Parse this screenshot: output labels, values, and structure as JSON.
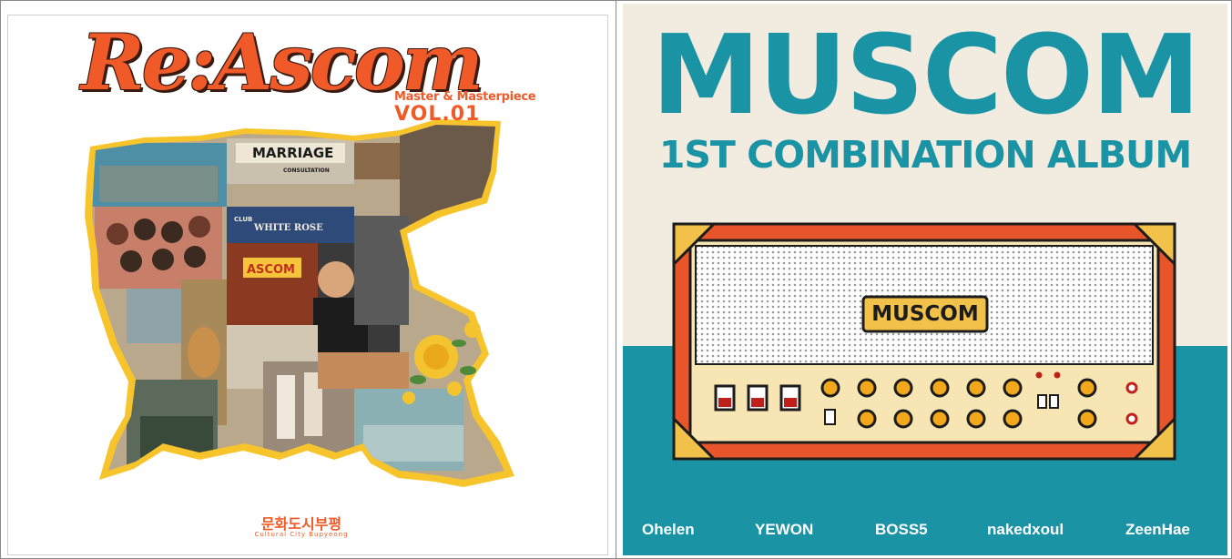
{
  "left_cover": {
    "title": "Re:Ascom",
    "subtitle": "Master & Masterpiece",
    "volume": "VOL.01",
    "signs": {
      "marriage": "MARRIAGE",
      "consultation": "CONSULTATION",
      "club": "CLUB",
      "white_rose": "WHITE ROSE",
      "ascom": "ASCOM"
    },
    "footer_logo": "문화도시부평",
    "footer_sub": "Cultural City Bupyeong"
  },
  "right_cover": {
    "title": "MUSCOM",
    "subtitle": "1ST COMBINATION ALBUM",
    "amp_label": "MUSCOM",
    "artists": [
      "Ohelen",
      "YEWON",
      "BOSS5",
      "nakedxoul",
      "ZeenHae"
    ]
  },
  "colors": {
    "orange": "#f05a28",
    "teal": "#1a94a5",
    "cream": "#f2ebe0",
    "amp_cream": "#f7e6b4",
    "amp_frame": "#e8552a"
  }
}
